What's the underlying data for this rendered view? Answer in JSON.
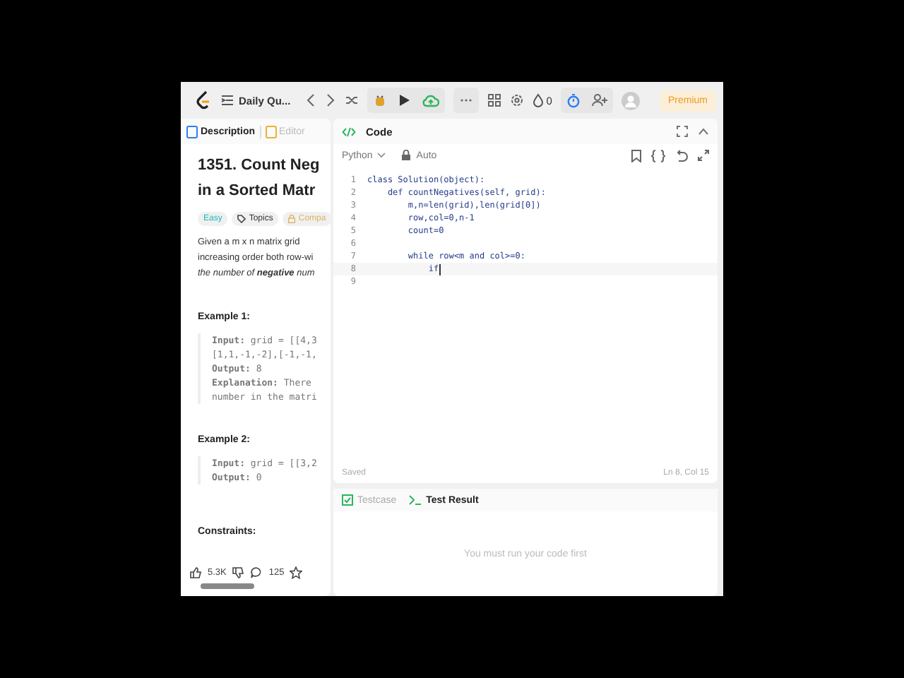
{
  "topbar": {
    "problem_list": "Daily Qu...",
    "streak": "0",
    "premium": "Premium"
  },
  "left_tabs": [
    {
      "label": "Description",
      "selected": true
    },
    {
      "label": "Editor",
      "selected": false
    }
  ],
  "problem": {
    "title_lines": [
      "1351. Count Neg",
      "in a Sorted Matr"
    ],
    "tags": [
      {
        "label": "Easy",
        "kind": "difficulty"
      },
      {
        "label": "Topics",
        "kind": "topics"
      },
      {
        "label": "Compa",
        "kind": "companies"
      }
    ],
    "description_lines": [
      {
        "text": "Given a m x n matrix grid",
        "italic": false
      },
      {
        "text": "increasing order both row-wi",
        "italic": false
      },
      {
        "text": "the number of **negative** num",
        "italic": true
      }
    ],
    "examples": [
      {
        "title": "Example 1:",
        "lines": [
          "**Input:** grid = [[4,3",
          "[1,1,-1,-2],[-1,-1,",
          "**Output:** 8",
          "**Explanation:** There",
          "number in the matri"
        ]
      },
      {
        "title": "Example 2:",
        "lines": [
          "**Input:** grid = [[3,2",
          "**Output:** 0"
        ]
      }
    ],
    "constraints_title": "Constraints:"
  },
  "reactions": {
    "likes": "5.3K",
    "comments": "125"
  },
  "code_panel": {
    "title": "Code",
    "language": "Python",
    "mode": "Auto",
    "lines": [
      {
        "number": "1",
        "text": "class Solution(object):",
        "current": false
      },
      {
        "number": "2",
        "text": "    def countNegatives(self, grid):",
        "current": false
      },
      {
        "number": "3",
        "text": "        m,n=len(grid),len(grid[0])",
        "current": false
      },
      {
        "number": "4",
        "text": "        row,col=0,n-1",
        "current": false
      },
      {
        "number": "5",
        "text": "        count=0",
        "current": false
      },
      {
        "number": "6",
        "current": false
      },
      {
        "number": "7",
        "text": "        while row<m and col>=0:",
        "current": false
      },
      {
        "number": "8",
        "text": "            if",
        "current": true
      },
      {
        "number": "9",
        "current": false
      }
    ],
    "status": "Saved",
    "position": "Ln 8, Col 15"
  },
  "bottom_tabs": [
    {
      "label": "Testcase",
      "selected": false
    },
    {
      "label": "Test Result",
      "selected": true
    }
  ],
  "result_message": "You must run your code first"
}
